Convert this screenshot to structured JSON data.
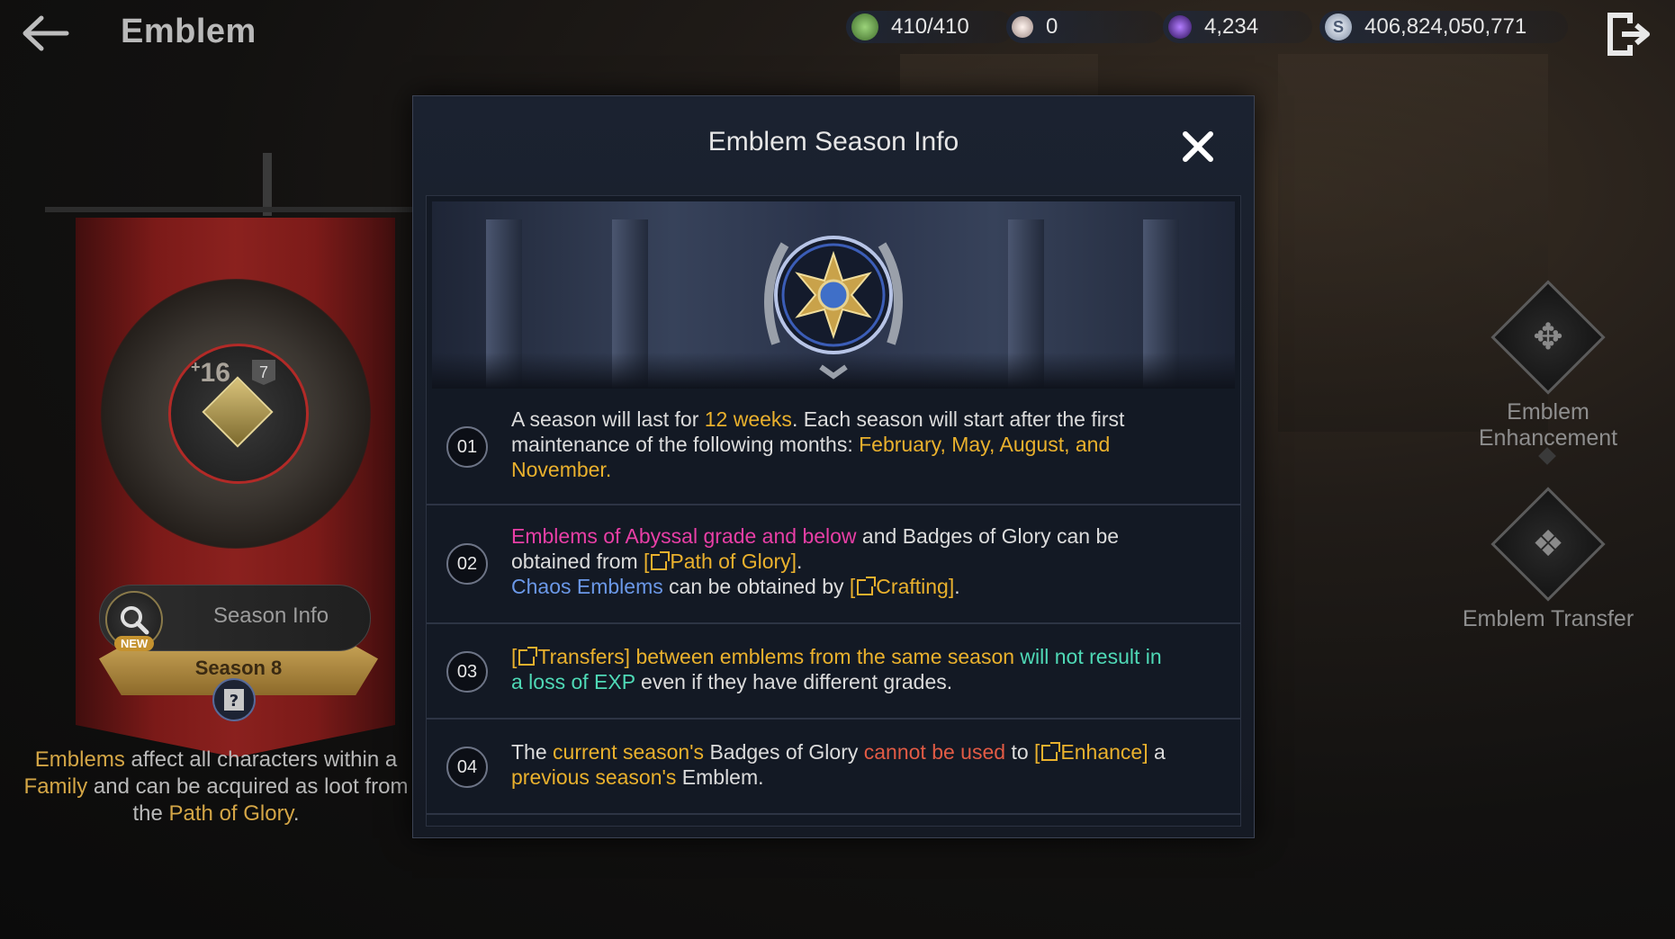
{
  "header": {
    "back_icon": "arrow-left-icon",
    "title": "Emblem",
    "currencies": [
      {
        "icon": "stamina-icon",
        "value": "410/410",
        "color": "#6aa84f"
      },
      {
        "icon": "pearl-icon",
        "value": "0",
        "color": "#d9c7c0"
      },
      {
        "icon": "dark-crystal-icon",
        "value": "4,234",
        "color": "#6a2fbf"
      },
      {
        "icon": "silver-icon",
        "value": "406,824,050,771",
        "color": "#c8d4e6"
      }
    ],
    "exit_icon": "exit-door-icon"
  },
  "left_panel": {
    "crest_level": "16",
    "crest_level_prefix": "+",
    "crest_tier": "7",
    "season_label": "Season 8",
    "season_info_button": "Season Info",
    "new_badge": "NEW",
    "description_part1": "Emblems",
    "description_part2": " affect all characters within a ",
    "description_part3": "Family",
    "description_part4": " and can be acquired as loot from the ",
    "description_part5": "Path of Glory",
    "description_part6": "."
  },
  "right_panel": {
    "enhancement_label": "Emblem Enhancement",
    "transfer_label": "Emblem Transfer"
  },
  "modal": {
    "title": "Emblem Season Info",
    "close_icon": "close-x-icon",
    "rows": [
      {
        "num": "01",
        "t1": "A season will last for ",
        "t2": "12 weeks",
        "t3": ". Each season will start after the first maintenance of the following months: ",
        "t4": "February, May, August, and November."
      },
      {
        "num": "02",
        "t1": "Emblems of Abyssal grade and below",
        "t2": " and Badges of Glory can be obtained from ",
        "t3": "[",
        "t4": "Path of Glory]",
        "t5": ".",
        "t6": "Chaos Emblems",
        "t7": " can be obtained by ",
        "t8": "[",
        "t9": "Crafting]",
        "t10": "."
      },
      {
        "num": "03",
        "t1": "[",
        "t2": "Transfers] between emblems from the same season",
        "t3": " will not result in a loss of EXP",
        "t4": " even if they have different grades."
      },
      {
        "num": "04",
        "t1": "The ",
        "t2": "current season's",
        "t3": " Badges of Glory ",
        "t4": "cannot be used",
        "t5": " to ",
        "t6": "[",
        "t7": "Enhance]",
        "t8": " a ",
        "t9": "previous season's",
        "t10": " Emblem."
      }
    ]
  }
}
